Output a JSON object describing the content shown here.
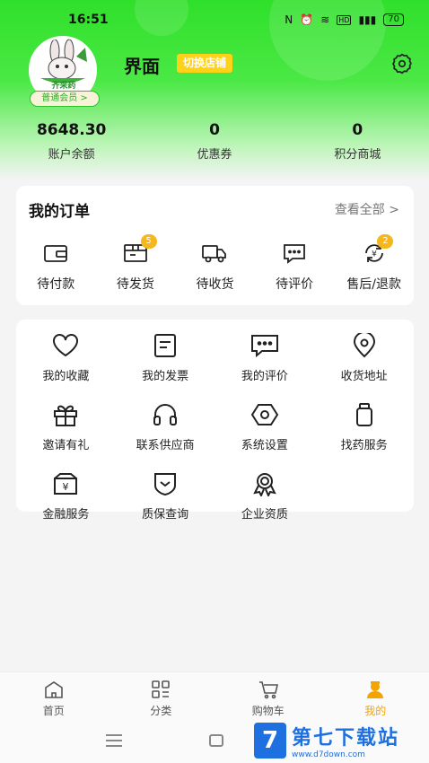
{
  "status_bar": {
    "time": "16:51",
    "icons": [
      "nfc-icon",
      "alarm-icon",
      "wifi-icon",
      "hd-icon",
      "signal-icon"
    ],
    "battery": "70"
  },
  "profile": {
    "store_name": "界面",
    "switch_store": "切换店铺",
    "member_level": "普通会员 >",
    "avatar_text": "齐采药"
  },
  "stats": [
    {
      "value": "8648.30",
      "label": "账户余额"
    },
    {
      "value": "0",
      "label": "优惠券"
    },
    {
      "value": "0",
      "label": "积分商城"
    }
  ],
  "orders": {
    "title": "我的订单",
    "view_all": "查看全部 >",
    "items": [
      {
        "label": "待付款",
        "icon": "wallet-icon",
        "badge": ""
      },
      {
        "label": "待发货",
        "icon": "package-icon",
        "badge": "5"
      },
      {
        "label": "待收货",
        "icon": "truck-icon",
        "badge": ""
      },
      {
        "label": "待评价",
        "icon": "comment-icon",
        "badge": ""
      },
      {
        "label": "售后/退款",
        "icon": "refund-icon",
        "badge": "2"
      }
    ]
  },
  "tools": [
    {
      "label": "我的收藏",
      "icon": "heart-icon"
    },
    {
      "label": "我的发票",
      "icon": "invoice-icon"
    },
    {
      "label": "我的评价",
      "icon": "review-icon"
    },
    {
      "label": "收货地址",
      "icon": "location-icon"
    },
    {
      "label": "邀请有礼",
      "icon": "gift-icon"
    },
    {
      "label": "联系供应商",
      "icon": "headset-icon"
    },
    {
      "label": "系统设置",
      "icon": "hex-settings-icon"
    },
    {
      "label": "找药服务",
      "icon": "medicine-icon"
    },
    {
      "label": "金融服务",
      "icon": "finance-icon"
    },
    {
      "label": "质保查询",
      "icon": "shield-icon"
    },
    {
      "label": "企业资质",
      "icon": "award-icon"
    }
  ],
  "nav": [
    {
      "label": "首页",
      "icon": "home-icon"
    },
    {
      "label": "分类",
      "icon": "category-icon"
    },
    {
      "label": "购物车",
      "icon": "cart-icon"
    },
    {
      "label": "我的",
      "icon": "profile-icon",
      "active": true
    }
  ],
  "watermark": {
    "logo": "7",
    "main": "第七下载站",
    "url": "www.d7down.com"
  },
  "colors": {
    "header_green": "#2fe02a",
    "accent_yellow": "#ffd21a",
    "badge_orange": "#f5b71b",
    "active_nav": "#f4a400"
  }
}
